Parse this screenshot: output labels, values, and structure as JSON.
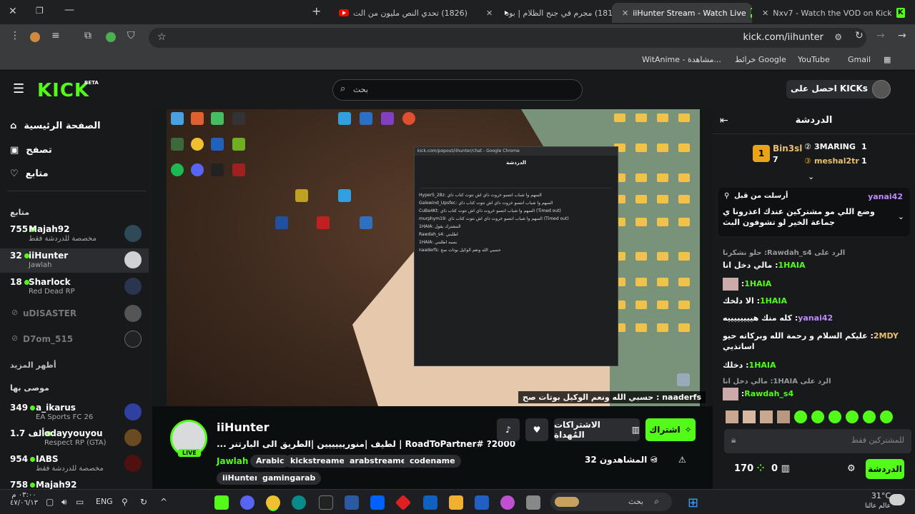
{
  "tabs": [
    {
      "label": "Nxv7 - Watch the VOD on Kick",
      "icon": "kick"
    },
    {
      "label": "iiHunter Stream - Watch Live",
      "icon": "kick"
    },
    {
      "label": "(1817) مجرم في جنح الظلام | بود",
      "icon": "youtube"
    },
    {
      "label": "(1826) تحدي النص مليون من الت",
      "icon": "youtube"
    }
  ],
  "toolbar": {
    "url": "kick.com/iihunter"
  },
  "bookmarks": [
    "Gmail",
    "YouTube",
    "خرائط Google",
    "WitAnime - مشاهدة..."
  ],
  "header": {
    "search_placeholder": "بحث",
    "logo": "KICK",
    "beta": "BETA",
    "get_kicks": "احصل على KICKs"
  },
  "sidebar": {
    "nav": [
      {
        "label": "الصفحة الرئيسية"
      },
      {
        "label": "تصفح"
      },
      {
        "label": "متابع"
      }
    ],
    "following_title": "متابع",
    "following": [
      {
        "viewers": "755",
        "name": "Majah92",
        "category": "مخصصة للدردشة فقط",
        "live": true
      },
      {
        "viewers": "32",
        "name": "iiHunter",
        "category": "Jawlah",
        "live": true
      },
      {
        "viewers": "18",
        "name": "Sharlock",
        "category": "Red Dead RP",
        "live": true
      },
      {
        "viewers": "",
        "name": "uDISASTER",
        "category": "",
        "live": false
      },
      {
        "viewers": "",
        "name": "D7om_515",
        "category": "",
        "live": false
      }
    ],
    "show_more": "أظهر المزيد",
    "recommended_title": "موصى بها",
    "recommended": [
      {
        "viewers": "349",
        "name": "a_ikarus",
        "category": "EA Sports FC 26"
      },
      {
        "viewers": "1.7 ألف",
        "name": "odayyouyou",
        "category": "Respect RP (GTA)"
      },
      {
        "viewers": "954",
        "name": "IABS",
        "category": "مخصصة للدردشة فقط"
      },
      {
        "viewers": "758",
        "name": "Majah92",
        "category": ""
      }
    ]
  },
  "video": {
    "overlay_text": "حسبي الله ونعم الوكيل بوتات صح : naaderfs",
    "inner_title": "kick.com/popout/iihunter/chat - Google Chrome",
    "inner_chat_title": "الدردشة",
    "inner_lines": [
      "HyperS_28z: السهم وا شباب انتسو خروت ذاي اش نتوت كتاب ذاي",
      "Galewind_Upsfec: السهم وا شباب انتسو خروت ذاي اش نتوت كتاب ذاي",
      "CuBa4Kt: السهم وا شباب انتسو خروت ذاي اش نتوت كتاب ذاي (Timed out)",
      "murphym19: السهم وا شباب انتسو خروت ذاي اش نتوت كتاب ذاي (Timed out)",
      "1HAIA: المشترك يقول",
      "Rawdah_s4: اطلبني",
      "1HAIA: بسبه اطلبني",
      "naaderfs: حسبي الله ونعم الوكيل بوتات صح"
    ]
  },
  "stream": {
    "name": "iiHunter",
    "live_label": "LIVE",
    "title": "... لطيف |منوريييييين |الطريق الى البارتنر | RoadToPartner# ?2000",
    "category": "Jawlah",
    "tags": [
      "Arabic",
      "kickstreamer",
      "arabstreamer",
      "codename",
      "iiHunter",
      "gamingarab"
    ],
    "viewers_label": "المشاهدون 32",
    "subscribe": "اشتراك",
    "gift_subs": "الاشتراكات المُهداة"
  },
  "chat": {
    "title": "الدردشة",
    "leaderboard": [
      {
        "rank": "1",
        "name": "Bin3sl",
        "count": "7"
      },
      {
        "rank": "1",
        "name": "3MARING",
        "count": "1"
      },
      {
        "rank": "1",
        "name": "meshal2tr",
        "count": "1"
      }
    ],
    "pinned_user": "yanai42",
    "pinned_label": "أرسلت من قبل",
    "pinned_text": "وضع اللي مو مشتركين عندك اعذرونا ي جماعة الخير لو تشوفون البث",
    "messages": [
      {
        "reply": "الرد على Rawdah_s4: حلو نشكرنا",
        "user": "",
        "text": ""
      },
      {
        "reply": "",
        "user": "1HAIA",
        "text": "مالي دخل انا"
      },
      {
        "reply": "",
        "user": "1HAIA",
        "text": ""
      },
      {
        "reply": "",
        "user": "1HAIA",
        "text": "الا دلخك"
      },
      {
        "reply": "",
        "user": "yanai42",
        "text": "كله منك هييييييييه"
      },
      {
        "reply": "",
        "user": "2MDY",
        "text": "عليكم السلام و رحمة الله وبركاته حيو اساتذيي"
      },
      {
        "reply": "",
        "user": "1HAIA",
        "text": "دخلك"
      },
      {
        "reply": "الرد على 1HAIA: مالي دخل انا",
        "user": "Rawdah_s4",
        "text": ""
      }
    ],
    "input_placeholder": "للمشتركين فقط",
    "points": "170",
    "gifts": "0",
    "send": "الدردشة"
  },
  "taskbar": {
    "time": "٠٣:٠٠ م",
    "date": "٤٧/٠٦/١٣",
    "lang": "ENG",
    "weather_temp": "31°C",
    "weather_desc": "عالم عالنا",
    "search": "بحث"
  },
  "colors": {
    "accent": "#53fc18",
    "bg": "#0b0e0f",
    "panel": "#18191b"
  }
}
